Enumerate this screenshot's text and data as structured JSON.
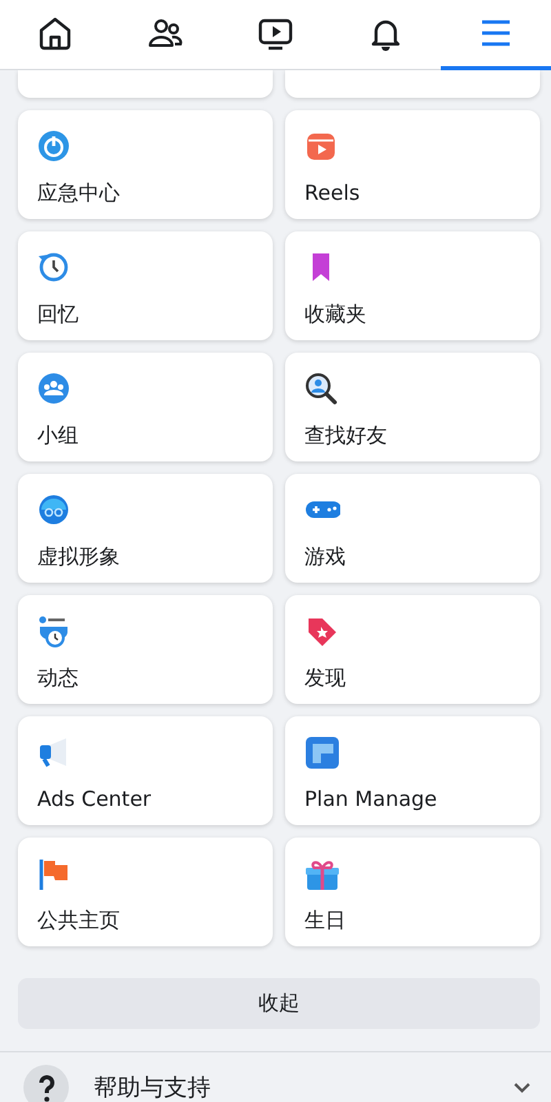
{
  "nav_tabs": [
    {
      "kind": "home",
      "selected": false
    },
    {
      "kind": "friends",
      "selected": false
    },
    {
      "kind": "video",
      "selected": false
    },
    {
      "kind": "bell",
      "selected": false
    },
    {
      "kind": "menu",
      "selected": true
    }
  ],
  "shortcuts": [
    {
      "label": "应急中心",
      "kind": "power"
    },
    {
      "label": "Reels",
      "kind": "reels"
    },
    {
      "label": "回忆",
      "kind": "clock"
    },
    {
      "label": "收藏夹",
      "kind": "bookmark"
    },
    {
      "label": "小组",
      "kind": "group"
    },
    {
      "label": "查找好友",
      "kind": "search"
    },
    {
      "label": "虚拟形象",
      "kind": "avatar"
    },
    {
      "label": "游戏",
      "kind": "gamepad"
    },
    {
      "label": "动态",
      "kind": "feed"
    },
    {
      "label": "发现",
      "kind": "tag"
    },
    {
      "label": "Ads Center",
      "kind": "megaphone"
    },
    {
      "label": "Plan Manage",
      "kind": "plan"
    },
    {
      "label": "公共主页",
      "kind": "flag"
    },
    {
      "label": "生日",
      "kind": "gift"
    }
  ],
  "collapse_button": "收起",
  "help_row": {
    "label": "帮助与支持",
    "expanded": false
  }
}
